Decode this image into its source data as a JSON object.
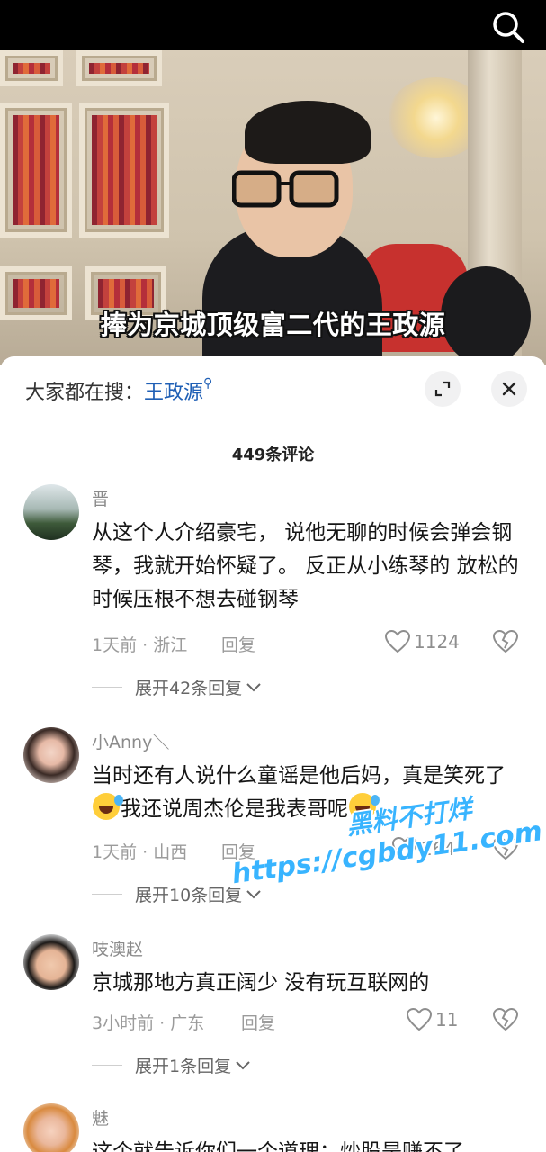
{
  "video": {
    "caption": "捧为京城顶级富二代的王政源"
  },
  "sheet": {
    "search_prefix": "大家都在搜：",
    "search_keyword": "王政源",
    "comment_count": "449条评论"
  },
  "comments": [
    {
      "username": "晋",
      "text": "从这个人介绍豪宅， 说他无聊的时候会弹会钢琴，我就开始怀疑了。 反正从小练琴的 放松的时候压根不想去碰钢琴",
      "time_location": "1天前 · 浙江",
      "reply_label": "回复",
      "likes": "1124",
      "expand_label": "展开42条回复"
    },
    {
      "username": "小Anny＼",
      "text_part1": "当时还有人说什么童谣是他后妈，真是笑死了",
      "text_part2": "我还说周杰伦是我表哥呢",
      "emoji": "rolling-on-floor-laughing-emoji",
      "time_location": "1天前 · 山西",
      "reply_label": "回复",
      "likes": "264",
      "expand_label": "展开10条回复"
    },
    {
      "username": "吱澳赵",
      "text": "京城那地方真正阔少 没有玩互联网的",
      "time_location": "3小时前 · 广东",
      "reply_label": "回复",
      "likes": "11",
      "expand_label": "展开1条回复"
    },
    {
      "username": "魅",
      "text": "这个就告诉你们一个道理：炒股是赚不了"
    }
  ],
  "watermark": {
    "line1": "黑料不打烊",
    "line2": "https://cgbdy11.com"
  },
  "icons": {
    "search": "search-icon",
    "expand": "expand-icon",
    "close": "close-icon",
    "like": "heart-icon",
    "dislike": "broken-heart-icon",
    "chevron": "chevron-down-icon"
  }
}
